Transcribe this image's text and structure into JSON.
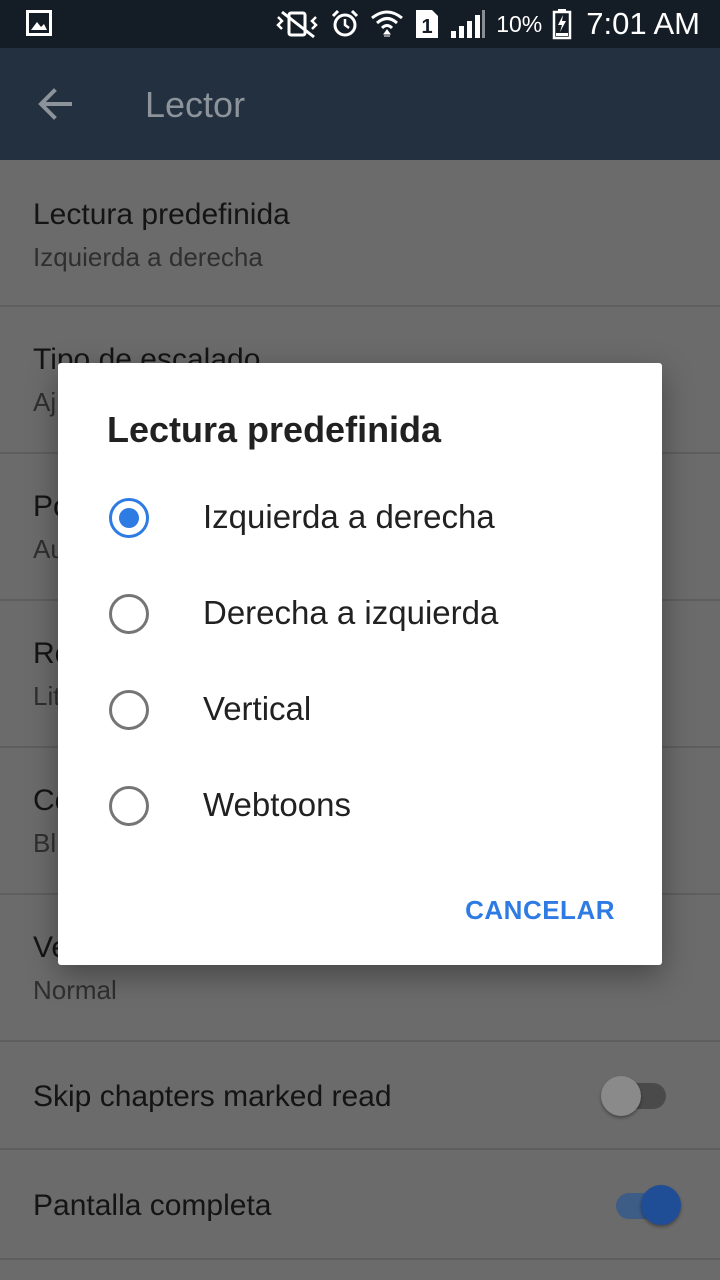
{
  "status_bar": {
    "battery_percent": "10%",
    "time": "7:01 AM",
    "sim_slot": "1"
  },
  "app_bar": {
    "title": "Lector"
  },
  "settings": [
    {
      "title": "Lectura predefinida",
      "subtitle": "Izquierda a derecha"
    },
    {
      "title": "Tipo de escalado",
      "subtitle": "Aj"
    },
    {
      "title": "Po",
      "subtitle": "Au"
    },
    {
      "title": "Ro",
      "subtitle": "Lit"
    },
    {
      "title": "Co",
      "subtitle": "Bl"
    },
    {
      "title": "Ve",
      "subtitle": "Normal"
    },
    {
      "title": "Skip chapters marked read",
      "toggle": false
    },
    {
      "title": "Pantalla completa",
      "toggle": true
    }
  ],
  "dialog": {
    "title": "Lectura predefinida",
    "options": [
      "Izquierda a derecha",
      "Derecha a izquierda",
      "Vertical",
      "Webtoons"
    ],
    "selected": "Izquierda a derecha",
    "cancel_label": "CANCELAR"
  },
  "colors": {
    "accent": "#2e7be3",
    "app_bar": "#23303f",
    "status_bar": "#141c26",
    "scrim_background": "#6b6b6b"
  },
  "icons": [
    "gallery-notification-icon",
    "mute-vibrate-icon",
    "alarm-icon",
    "wifi-icon",
    "sim-icon",
    "signal-icon",
    "battery-charging-icon",
    "back-arrow-icon"
  ]
}
